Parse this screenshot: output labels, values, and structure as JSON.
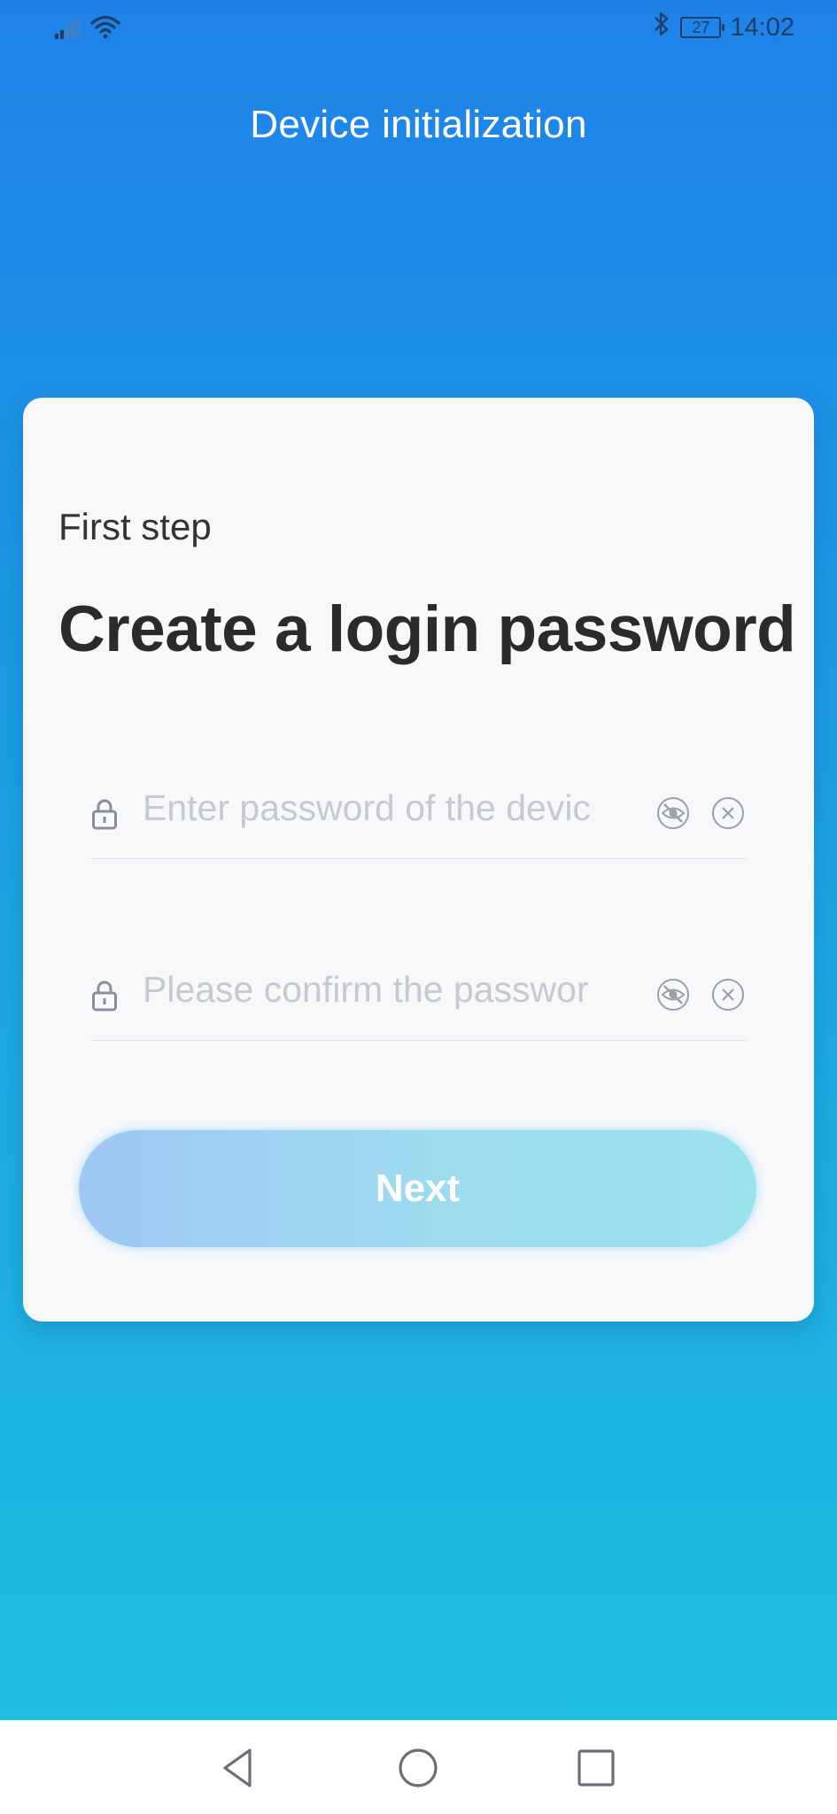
{
  "status_bar": {
    "signal_icon": "signal-bars-icon",
    "wifi_icon": "wifi-icon",
    "bluetooth_icon": "bluetooth-icon",
    "battery_level": "27",
    "time": "14:02"
  },
  "header": {
    "title": "Device initialization"
  },
  "card": {
    "step_label": "First step",
    "heading": "Create a login password",
    "password_field": {
      "placeholder": "Enter password of the devic",
      "lock_icon": "lock-icon",
      "visibility_icon": "eye-hidden-icon",
      "clear_icon": "clear-circle-icon"
    },
    "confirm_field": {
      "placeholder": "Please confirm the passwor",
      "lock_icon": "lock-icon",
      "visibility_icon": "eye-hidden-icon",
      "clear_icon": "clear-circle-icon"
    },
    "next_label": "Next"
  },
  "nav_bar": {
    "back_icon": "back-triangle-icon",
    "home_icon": "home-circle-icon",
    "recents_icon": "recents-square-icon"
  },
  "colors": {
    "background_top": "#1f82e8",
    "background_bottom": "#1fbde0",
    "card": "#f6f8fa",
    "button_start": "#9ec7f2",
    "button_end": "#9be2ef",
    "placeholder_text": "#c6c9cd"
  }
}
